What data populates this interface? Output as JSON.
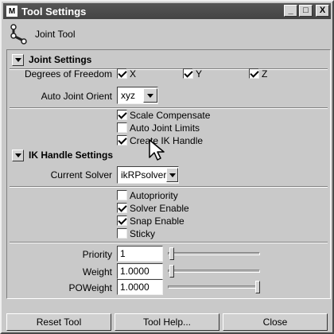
{
  "window": {
    "title": "Tool Settings",
    "app_icon": "maya-m-icon",
    "min_label": "_",
    "max_label": "□",
    "close_label": "X"
  },
  "tool": {
    "name": "Joint Tool",
    "icon": "joint-tool-icon"
  },
  "joint_settings": {
    "title": "Joint Settings",
    "dof_label": "Degrees of Freedom",
    "dof": [
      {
        "label": "X",
        "checked": true
      },
      {
        "label": "Y",
        "checked": true
      },
      {
        "label": "Z",
        "checked": true
      }
    ],
    "orient_label": "Auto Joint Orient",
    "orient_value": "xyz",
    "options": [
      {
        "label": "Scale Compensate",
        "checked": true
      },
      {
        "label": "Auto Joint Limits",
        "checked": false
      },
      {
        "label": "Create IK Handle",
        "checked": true
      }
    ]
  },
  "ik_settings": {
    "title": "IK Handle Settings",
    "solver_label": "Current Solver",
    "solver_value": "ikRPsolver",
    "options": [
      {
        "label": "Autopriority",
        "checked": false
      },
      {
        "label": "Solver Enable",
        "checked": true
      },
      {
        "label": "Snap Enable",
        "checked": true
      },
      {
        "label": "Sticky",
        "checked": false
      }
    ],
    "priority_label": "Priority",
    "priority_value": "1",
    "weight_label": "Weight",
    "weight_value": "1.0000",
    "poweight_label": "POWeight",
    "poweight_value": "1.0000",
    "priority_level": 0.0,
    "weight_level": 0.0,
    "poweight_level": 1.0
  },
  "buttons": {
    "reset": "Reset Tool",
    "help": "Tool Help...",
    "close": "Close"
  }
}
